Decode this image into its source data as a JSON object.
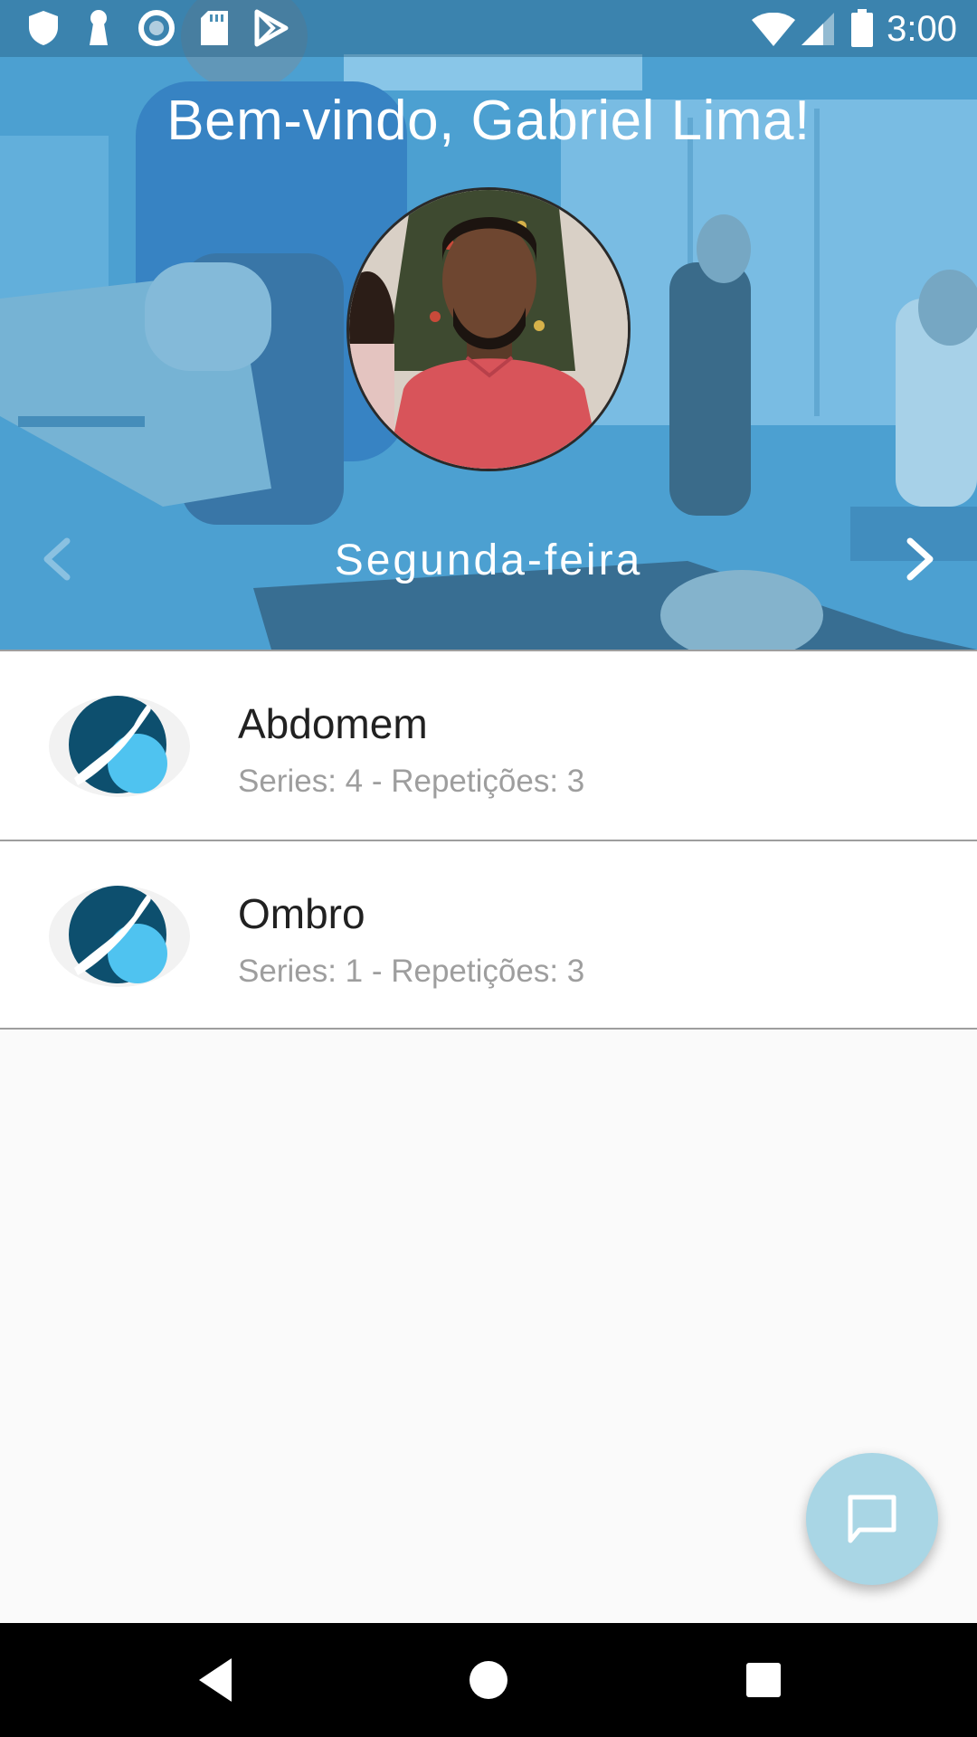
{
  "status_bar": {
    "time": "3:00",
    "left_icons": [
      "shield-icon",
      "keyhole-icon",
      "circle-icon",
      "sd-card-icon",
      "play-store-icon"
    ],
    "right_icons": [
      "wifi-icon",
      "signal-icon",
      "battery-icon"
    ]
  },
  "header": {
    "welcome": "Bem-vindo, Gabriel Lima!",
    "day": "Segunda-feira",
    "prev_icon": "chevron-left-icon",
    "next_icon": "chevron-right-icon"
  },
  "exercises": [
    {
      "title": "Abdomem",
      "subtitle": "Series: 4 - Repetições: 3"
    },
    {
      "title": "Ombro",
      "subtitle": "Series: 1 - Repetições: 3"
    }
  ],
  "fab": {
    "icon": "chat-icon"
  },
  "colors": {
    "header_tint": "#3d93c3",
    "logo_dark": "#0d4f6e",
    "logo_light": "#4fc3f0",
    "fab": "#a9d6e5"
  }
}
